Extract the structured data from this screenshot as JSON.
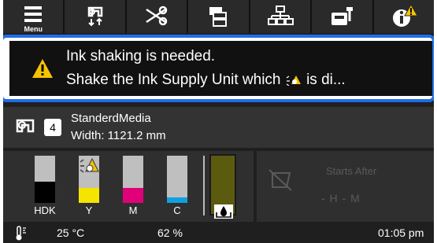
{
  "toolbar": {
    "menu_label": "Menu",
    "buttons": [
      "menu",
      "media-feed",
      "cutter",
      "media-settings",
      "network",
      "printer-maintenance",
      "information-warning"
    ]
  },
  "alert": {
    "line1": "Ink shaking is needed.",
    "line2_a": "Shake the Ink Supply Unit which",
    "line2_b": "is di..."
  },
  "media": {
    "count": "4",
    "name": "StanderdMedia",
    "width": "Width: 1121.2 mm"
  },
  "inks": [
    {
      "label": "HDK",
      "color": "#000000",
      "level": 0.45
    },
    {
      "label": "Y",
      "color": "#f4e400",
      "level": 0.32,
      "warning": true
    },
    {
      "label": "M",
      "color": "#e0007a",
      "level": 0.32
    },
    {
      "label": "C",
      "color": "#10a0e0",
      "level": 0.12
    }
  ],
  "maintenance": {
    "color": "#5b5b10"
  },
  "timer": {
    "starts_label": "Starts After",
    "hm": "- H - M"
  },
  "status": {
    "temperature": "25 °C",
    "humidity": "62 %",
    "time": "01:05 pm"
  }
}
